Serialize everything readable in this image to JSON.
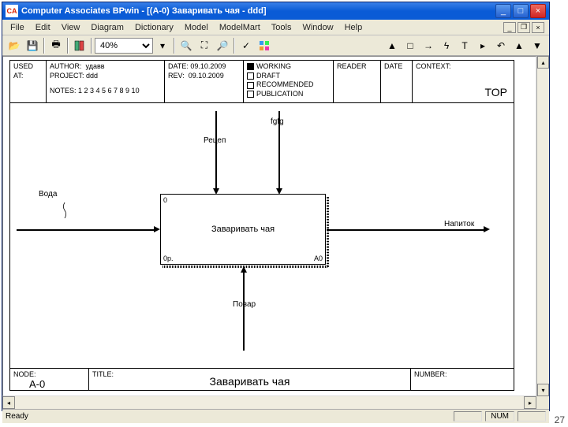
{
  "window": {
    "favicon_text": "CA",
    "title": "Computer Associates BPwin - [(A-0) Заваривать чая - ddd]"
  },
  "menu": {
    "file": "File",
    "edit": "Edit",
    "view": "View",
    "diagram": "Diagram",
    "dictionary": "Dictionary",
    "model": "Model",
    "modelmart": "ModelMart",
    "tools": "Tools",
    "window": "Window",
    "help": "Help"
  },
  "toolbar": {
    "zoom": "40%"
  },
  "idef": {
    "header": {
      "used_at": "USED AT:",
      "author_label": "AUTHOR:",
      "author": "удавв",
      "project_label": "PROJECT:",
      "project": "ddd",
      "notes_label": "NOTES:  1  2  3  4  5  6  7  8  9  10",
      "date_label": "DATE:",
      "date": "09.10.2009",
      "rev_label": "REV:",
      "rev": "09.10.2009",
      "status": {
        "working": "WORKING",
        "draft": "DRAFT",
        "recommended": "RECOMMENDED",
        "publication": "PUBLICATION"
      },
      "reader": "READER",
      "date2": "DATE",
      "context": "CONTEXT:",
      "top": "TOP"
    },
    "body": {
      "activity": "Заваривать чая",
      "activity_corner": "0",
      "activity_a0": "A0",
      "input": "Вода",
      "output": "Напиток",
      "control1": "Рецеп",
      "control2": "fgfg",
      "mechanism": "Повар"
    },
    "footer": {
      "node_label": "NODE:",
      "node": "A-0",
      "title_label": "TITLE:",
      "title": "Заваривать чая",
      "number_label": "NUMBER:"
    }
  },
  "status": {
    "ready": "Ready",
    "num": "NUM"
  },
  "page": "27"
}
